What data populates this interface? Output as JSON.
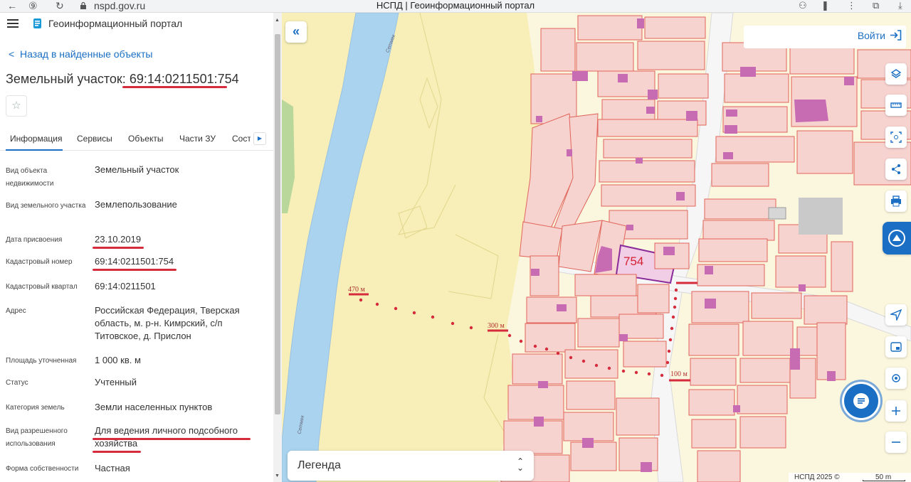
{
  "browser": {
    "url": "nspd.gov.ru",
    "page_title": "НСПД | Геоинформационный портал"
  },
  "header": {
    "portal_name": "Геоинформационный портал"
  },
  "back_link": "Назад в найденные объекты",
  "object": {
    "title_prefix": "Земельный участок:",
    "cadastral_number": "69:14:0211501:754"
  },
  "tabs": [
    {
      "label": "Информация"
    },
    {
      "label": "Сервисы"
    },
    {
      "label": "Объекты"
    },
    {
      "label": "Части ЗУ"
    },
    {
      "label": "Состав"
    }
  ],
  "properties": [
    {
      "label": "Вид объекта недвижимости",
      "value": "Земельный участок"
    },
    {
      "label": "Вид земельного участка",
      "value": "Землепользование"
    },
    {
      "label": "Дата присвоения",
      "value": "23.10.2019"
    },
    {
      "label": "Кадастровый номер",
      "value": "69:14:0211501:754"
    },
    {
      "label": "Кадастровый квартал",
      "value": "69:14:0211501"
    },
    {
      "label": "Адрес",
      "value": "Российская Федерация, Тверская область, м. р-н. Кимрский, с/п Титовское, д. Прислон"
    },
    {
      "label": "Площадь уточненная",
      "value": "1 000 кв. м"
    },
    {
      "label": "Статус",
      "value": "Учтенный"
    },
    {
      "label": "Категория земель",
      "value": "Земли населенных пунктов"
    },
    {
      "label": "Вид разрешенного использования",
      "value": "Для ведения личного подсобного хозяйства"
    },
    {
      "label": "Форма собственности",
      "value": "Частная"
    }
  ],
  "map": {
    "login_label": "Войти",
    "parcel_label": "754",
    "legend_label": "Легенда",
    "attribution": "НСПД 2025 ©",
    "scale_label": "50 m",
    "river_labels": [
      "Сетмек",
      "Сетмек"
    ],
    "distance_marks": [
      "470 м",
      "300 м",
      "100 м"
    ],
    "colors": {
      "parcel_fill": "#f7d3d0",
      "parcel_stroke": "#e0645a",
      "building": "#c76bb3",
      "river": "#a9d3ee",
      "field": "#f7efb7",
      "highlight": "#8a2b9a",
      "annotation_red": "#d52b3c"
    }
  },
  "toolbar_icons": [
    "layers-icon",
    "ruler-icon",
    "select-area-icon",
    "share-icon",
    "print-icon",
    "assistant-icon",
    "locate-icon",
    "minimap-icon",
    "pin-icon",
    "zoom-in-icon",
    "zoom-out-icon"
  ]
}
